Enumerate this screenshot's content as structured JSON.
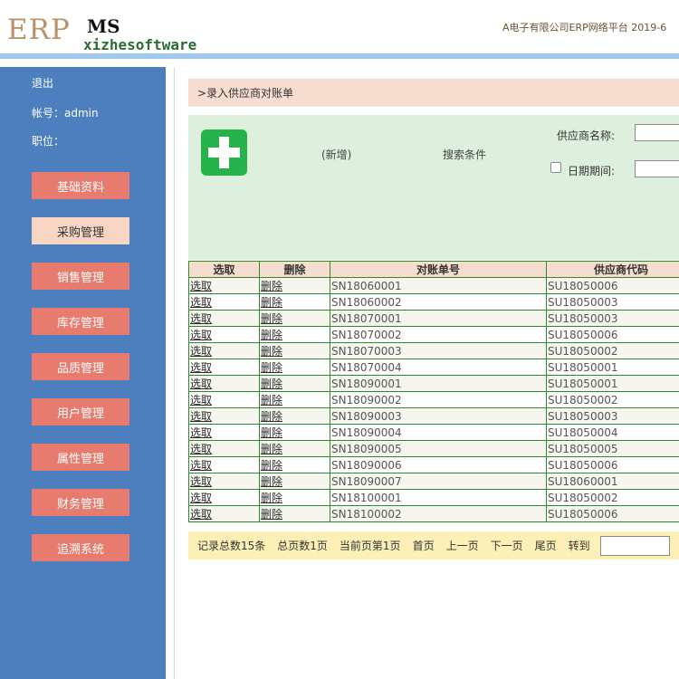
{
  "header": {
    "logo_erp": "ERP",
    "logo_ms": "MS",
    "logo_company": "xizhesoftware",
    "platform": "A电子有限公司ERP网络平台  2019-6"
  },
  "sidebar": {
    "logout": "退出",
    "account": "帐号：admin",
    "position": "职位：",
    "menu": [
      {
        "label": "基础资料",
        "active": false
      },
      {
        "label": "采购管理",
        "active": true
      },
      {
        "label": "销售管理",
        "active": false
      },
      {
        "label": "库存管理",
        "active": false
      },
      {
        "label": "品质管理",
        "active": false
      },
      {
        "label": "用户管理",
        "active": false
      },
      {
        "label": "属性管理",
        "active": false
      },
      {
        "label": "财务管理",
        "active": false
      },
      {
        "label": "追溯系统",
        "active": false
      }
    ]
  },
  "breadcrumb": ">录入供应商对账单",
  "search": {
    "new_label": "(新增)",
    "condition_label": "搜索条件",
    "supplier_label": "供应商名称:",
    "supplier_value": "",
    "date_label": "日期期间:",
    "date_value": "",
    "date_checked": false
  },
  "table": {
    "headers": [
      "选取",
      "删除",
      "对账单号",
      "供应商代码"
    ],
    "rows": [
      {
        "select": "选取",
        "delete": "删除",
        "no": "SN18060001",
        "supplier": "SU18050006"
      },
      {
        "select": "选取",
        "delete": "删除",
        "no": "SN18060002",
        "supplier": "SU18050003"
      },
      {
        "select": "选取",
        "delete": "删除",
        "no": "SN18070001",
        "supplier": "SU18050003"
      },
      {
        "select": "选取",
        "delete": "删除",
        "no": "SN18070002",
        "supplier": "SU18050006"
      },
      {
        "select": "选取",
        "delete": "删除",
        "no": "SN18070003",
        "supplier": "SU18050002"
      },
      {
        "select": "选取",
        "delete": "删除",
        "no": "SN18070004",
        "supplier": "SU18050001"
      },
      {
        "select": "选取",
        "delete": "删除",
        "no": "SN18090001",
        "supplier": "SU18050001"
      },
      {
        "select": "选取",
        "delete": "删除",
        "no": "SN18090002",
        "supplier": "SU18050002"
      },
      {
        "select": "选取",
        "delete": "删除",
        "no": "SN18090003",
        "supplier": "SU18050003"
      },
      {
        "select": "选取",
        "delete": "删除",
        "no": "SN18090004",
        "supplier": "SU18050004"
      },
      {
        "select": "选取",
        "delete": "删除",
        "no": "SN18090005",
        "supplier": "SU18050005"
      },
      {
        "select": "选取",
        "delete": "删除",
        "no": "SN18090006",
        "supplier": "SU18050006"
      },
      {
        "select": "选取",
        "delete": "删除",
        "no": "SN18090007",
        "supplier": "SU18060001"
      },
      {
        "select": "选取",
        "delete": "删除",
        "no": "SN18100001",
        "supplier": "SU18050002"
      },
      {
        "select": "选取",
        "delete": "删除",
        "no": "SN18100002",
        "supplier": "SU18050006"
      }
    ]
  },
  "pager": {
    "total": "记录总数15条",
    "pages": "总页数1页",
    "current": "当前页第1页",
    "first": "首页",
    "prev": "上一页",
    "next": "下一页",
    "last": "尾页",
    "goto": "转到",
    "goto_value": ""
  },
  "colors": {
    "sidebar_bg": "#4d7fbf",
    "menu_button": "#e67b6e",
    "menu_button_active": "#f7d5c2",
    "panel_green": "#ddefdd",
    "add_green": "#26b34a",
    "table_border": "#2d8a2d",
    "header_peach": "#f7dcd0",
    "pager_yellow": "#fdf0b7"
  },
  "icons": {
    "add": "plus-icon"
  }
}
